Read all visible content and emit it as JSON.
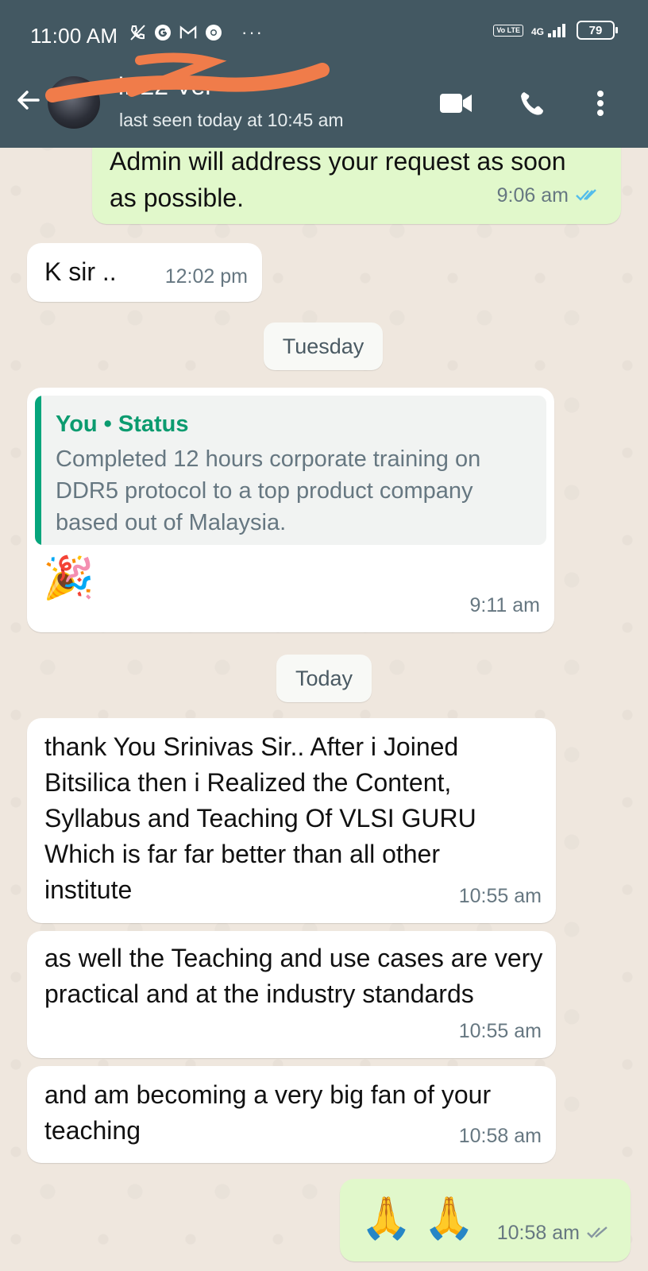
{
  "status_bar": {
    "time": "11:00 AM",
    "network": "4G",
    "volte": "Vo LTE",
    "battery": "79"
  },
  "header": {
    "contact_name": "Ir        22 Ver",
    "last_seen": "last seen today at 10:45 am",
    "bg_color": "#435862"
  },
  "messages": [
    {
      "type": "out",
      "text": "Admin will address your request as soon as possible.",
      "time": "9:06 am",
      "ticks": "read"
    },
    {
      "type": "in",
      "text": "K sir ..",
      "time": "12:02 pm"
    },
    {
      "type": "day",
      "label": "Tuesday"
    },
    {
      "type": "in",
      "quote_title": "You • Status",
      "quote_text": "Completed 12 hours corporate training on DDR5 protocol to a top product company based out of Malaysia.",
      "emoji": "🎉",
      "time": "9:11 am"
    },
    {
      "type": "day",
      "label": "Today"
    },
    {
      "type": "in",
      "text": "thank You Srinivas Sir.. After i Joined Bitsilica then i Realized the Content, Syllabus and Teaching  Of VLSI GURU Which is far far better than all other institute",
      "time": "10:55 am"
    },
    {
      "type": "in",
      "text": "as well the Teaching and use cases are very practical and at the industry standards",
      "time": "10:55 am"
    },
    {
      "type": "in",
      "text": "and am becoming a very big fan of your teaching",
      "time": "10:58 am"
    },
    {
      "type": "out",
      "emoji": "🙏 🙏",
      "time": "10:58 am",
      "ticks": "delivered"
    }
  ],
  "colors": {
    "incoming": "#ffffff",
    "outgoing": "#e1f8cb",
    "read_tick": "#53bdeb",
    "accent": "#06a57c"
  }
}
